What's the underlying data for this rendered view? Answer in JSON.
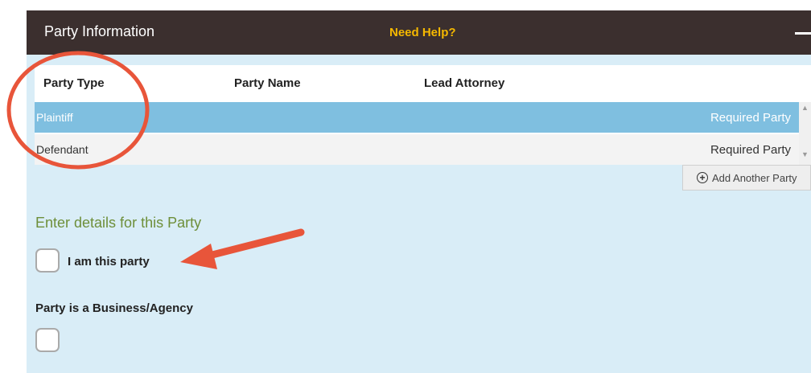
{
  "header": {
    "title": "Party Information",
    "help_label": "Need Help?"
  },
  "table": {
    "columns": [
      "Party Type",
      "Party Name",
      "Lead Attorney"
    ],
    "rows": [
      {
        "party_type": "Plaintiff",
        "status": "Required Party",
        "selected": true
      },
      {
        "party_type": "Defendant",
        "status": "Required Party",
        "selected": false
      }
    ]
  },
  "add_button": {
    "label": "Add Another Party"
  },
  "details": {
    "title": "Enter details for this Party",
    "i_am_this_party_label": "I am this party",
    "business_label": "Party is a Business/Agency"
  },
  "colors": {
    "header_bg": "#3b2f2e",
    "help_text": "#f5b800",
    "panel_bg": "#d9edf7",
    "selected_row": "#7fbfe0",
    "annotation": "#e8553a",
    "section_title": "#6e8f3a"
  }
}
